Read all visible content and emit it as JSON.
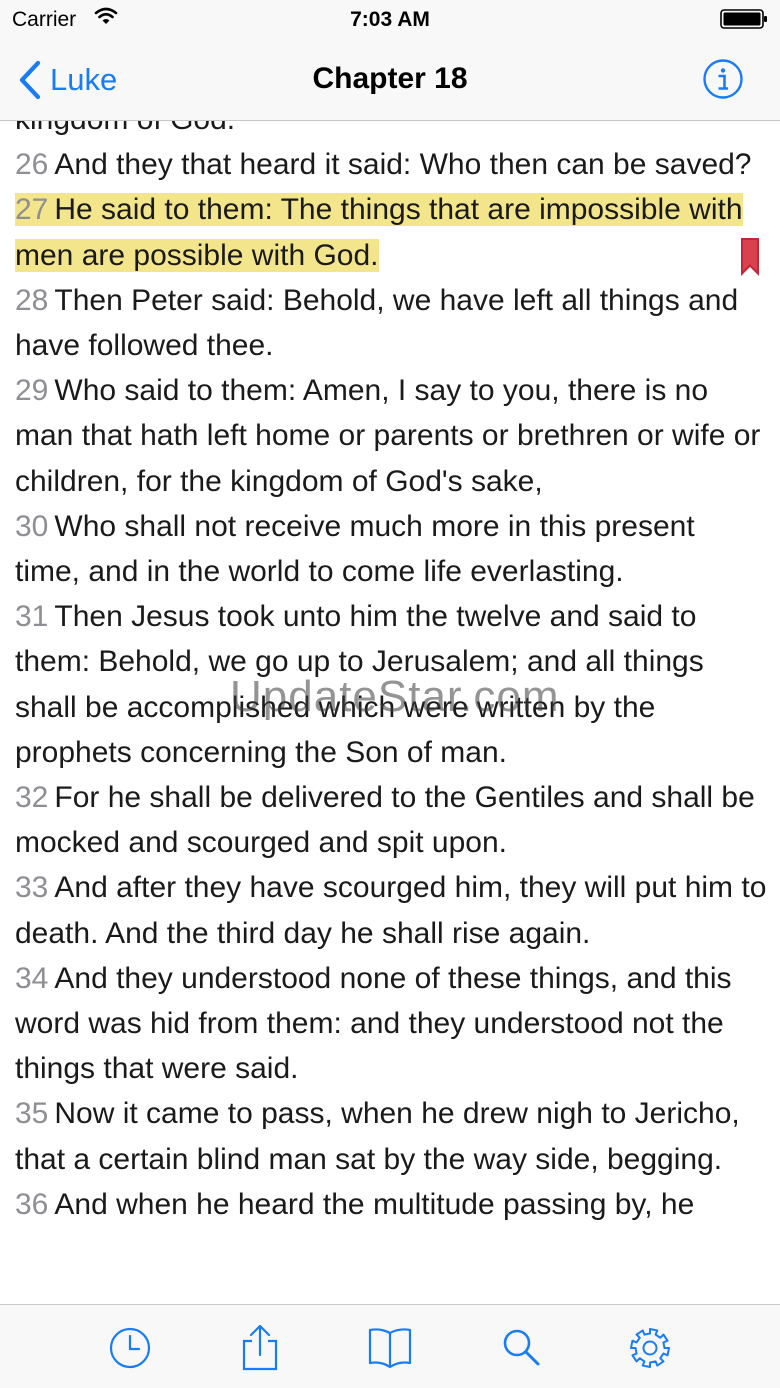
{
  "status_bar": {
    "carrier": "Carrier",
    "time": "7:03 AM"
  },
  "nav": {
    "back_label": "Luke",
    "title": "Chapter 18"
  },
  "partial_top_text": "kingdom of God.",
  "verses": [
    {
      "num": "26",
      "text": "And they that heard it said: Who then can be saved?",
      "highlighted": false
    },
    {
      "num": "27",
      "text": "He said to them: The things that are impossible with men are possible with God.",
      "highlighted": true
    },
    {
      "num": "28",
      "text": "Then Peter said: Behold, we have left all things and have followed thee.",
      "highlighted": false
    },
    {
      "num": "29",
      "text": "Who said to them: Amen, I say to you, there is no man that hath left home or parents or brethren or wife or children, for the kingdom of God's sake,",
      "highlighted": false
    },
    {
      "num": "30",
      "text": "Who shall not receive much more in this present time, and in the world to come life everlasting.",
      "highlighted": false
    },
    {
      "num": "31",
      "text": "Then Jesus took unto him the twelve and said to them: Behold, we go up to Jerusalem; and all things shall be accomplished which were written by the prophets concerning the Son of man.",
      "highlighted": false
    },
    {
      "num": "32",
      "text": "For he shall be delivered to the Gentiles and shall be mocked and scourged and spit upon.",
      "highlighted": false
    },
    {
      "num": "33",
      "text": "And after they have scourged him, they will put him to death. And the third day he shall rise again.",
      "highlighted": false
    },
    {
      "num": "34",
      "text": "And they understood none of these things, and this word was hid from them: and they understood not the things that were said.",
      "highlighted": false
    },
    {
      "num": "35",
      "text": "Now it came to pass, when he drew nigh to Jericho, that a certain blind man sat by the way side, begging.",
      "highlighted": false
    },
    {
      "num": "36",
      "text": "And when he heard the multitude passing by, he",
      "highlighted": false
    }
  ],
  "watermark": "UpdateStar.com",
  "tab_bar": {
    "items": [
      {
        "icon": "history-clock-icon"
      },
      {
        "icon": "share-icon"
      },
      {
        "icon": "book-icon"
      },
      {
        "icon": "search-icon"
      },
      {
        "icon": "settings-gear-icon"
      }
    ]
  },
  "colors": {
    "accent": "#1a7cf5",
    "highlight": "#f3e58b",
    "bookmark": "#c0283a",
    "verse_number": "#8e8e93"
  }
}
